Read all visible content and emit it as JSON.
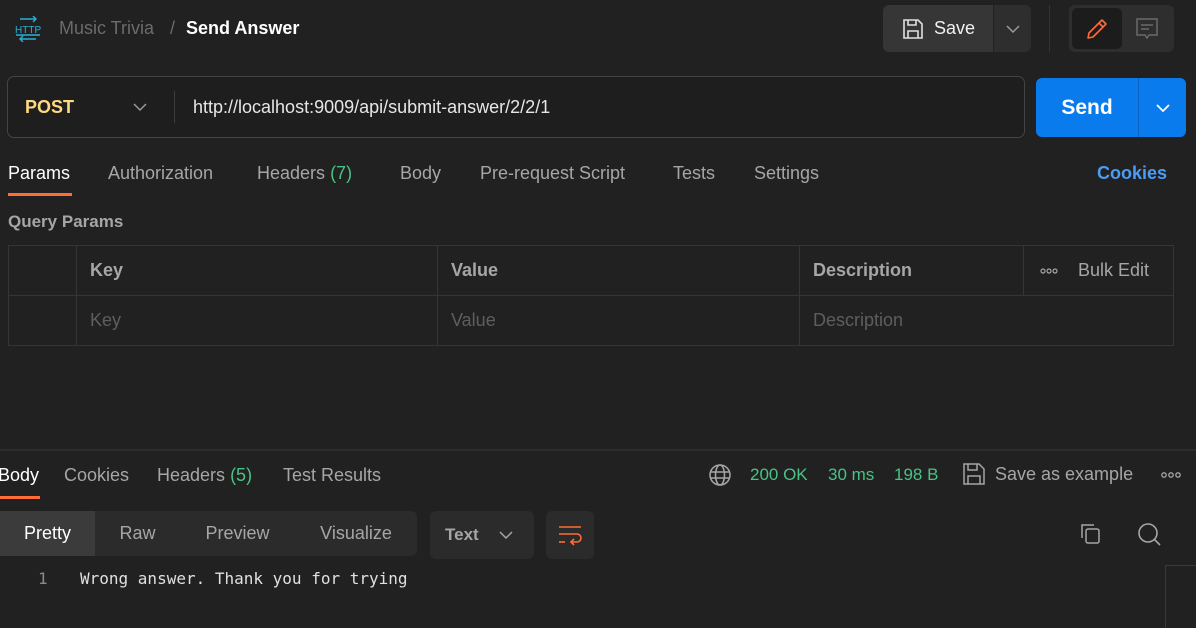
{
  "header": {
    "icon": "http-icon",
    "breadcrumb_parent": "Music Trivia",
    "breadcrumb_separator": "/",
    "breadcrumb_current": "Send Answer",
    "save_label": "Save"
  },
  "request": {
    "method": "POST",
    "url": "http://localhost:9009/api/submit-answer/2/2/1",
    "send_label": "Send"
  },
  "request_tabs": {
    "params": "Params",
    "authorization": "Authorization",
    "headers": "Headers",
    "headers_count": "(7)",
    "body": "Body",
    "prerequest": "Pre-request Script",
    "tests": "Tests",
    "settings": "Settings",
    "active": "Params",
    "cookies_link": "Cookies"
  },
  "query_params": {
    "title": "Query Params",
    "columns": [
      "Key",
      "Value",
      "Description"
    ],
    "bulk_edit": "Bulk Edit",
    "placeholders": {
      "key": "Key",
      "value": "Value",
      "description": "Description"
    }
  },
  "response": {
    "tabs": {
      "body": "Body",
      "cookies": "Cookies",
      "headers": "Headers",
      "headers_count": "(5)",
      "test_results": "Test Results",
      "active": "Body"
    },
    "status": "200 OK",
    "time": "30 ms",
    "size": "198 B",
    "save_example": "Save as example",
    "view_modes": [
      "Pretty",
      "Raw",
      "Preview",
      "Visualize"
    ],
    "active_view": "Pretty",
    "format": "Text",
    "lines": [
      {
        "number": "1",
        "text": "Wrong answer. Thank you for trying"
      }
    ]
  },
  "colors": {
    "accent": "#ff6c37",
    "send": "#097bed",
    "method_post": "#ffd97d",
    "success": "#49c285",
    "link": "#4a9cf5"
  }
}
